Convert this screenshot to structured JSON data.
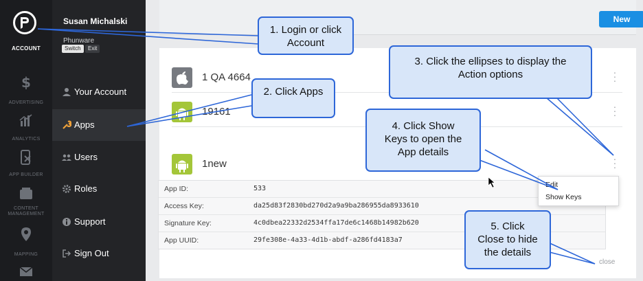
{
  "rail": {
    "items": [
      {
        "label": "ACCOUNT",
        "icon": "phunware-logo-icon",
        "active": true
      },
      {
        "label": "ADVERTISING",
        "icon": "dollar-icon"
      },
      {
        "label": "ANALYTICS",
        "icon": "bar-chart-icon"
      },
      {
        "label": "APP BUILDER",
        "icon": "phone-tool-icon"
      },
      {
        "label": "CONTENT MANAGEMENT",
        "icon": "inbox-icon"
      },
      {
        "label": "MAPPING",
        "icon": "map-pin-icon"
      },
      {
        "label": "",
        "icon": "envelope-icon"
      }
    ]
  },
  "panel": {
    "user_name": "Susan Michalski",
    "company": "Phunware",
    "switch_label": "Switch",
    "exit_label": "Exit",
    "nav": [
      {
        "label": "Your Account",
        "icon": "user-icon"
      },
      {
        "label": "Apps",
        "icon": "wrench-icon",
        "active": true
      },
      {
        "label": "Users",
        "icon": "users-icon"
      },
      {
        "label": "Roles",
        "icon": "cog-icon"
      },
      {
        "label": "Support",
        "icon": "info-icon"
      },
      {
        "label": "Sign Out",
        "icon": "sign-out-icon"
      }
    ]
  },
  "header": {
    "new_label": "New"
  },
  "apps": [
    {
      "name": "1 QA 4664",
      "platform": "apple-icon"
    },
    {
      "name": "19161",
      "platform": "android-icon"
    },
    {
      "name": "1new",
      "platform": "android-icon"
    }
  ],
  "details": [
    {
      "label": "App ID:",
      "value": "533"
    },
    {
      "label": "Access Key:",
      "value": "da25d83f2830bd270d2a9a9ba286955da8933610"
    },
    {
      "label": "Signature Key:",
      "value": "4c0dbea22332d2534ffa17de6c1468b14982b620"
    },
    {
      "label": "App UUID:",
      "value": "29fe308e-4a33-4d1b-abdf-a286fd4183a7"
    }
  ],
  "close_label": "close",
  "menu": {
    "edit": "Edit",
    "show_keys": "Show Keys"
  },
  "callouts": {
    "c1": "1. Login or click Account",
    "c2": "2. Click Apps",
    "c3": "3. Click the ellipses to display the Action options",
    "c4": "4. Click Show Keys to open the App details",
    "c5": "5. Click Close to hide the details"
  },
  "colors": {
    "accent": "#1a8fe3",
    "callout_fill": "#d8e6f9",
    "callout_border": "#2d66d8",
    "android_green": "#a4c639",
    "apple_gray": "#777a80"
  }
}
